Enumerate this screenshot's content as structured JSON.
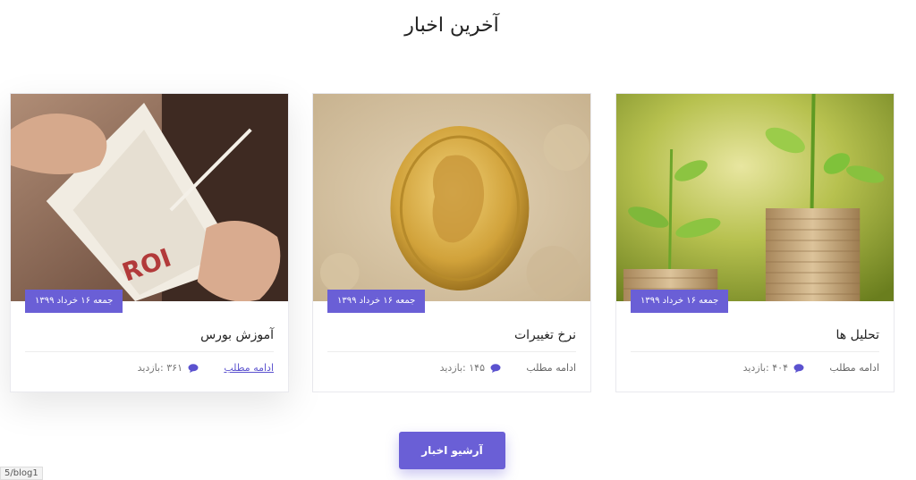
{
  "section": {
    "title": "آخرین اخبار"
  },
  "cards": [
    {
      "date": "جمعه ۱۶ خرداد ۱۳۹۹",
      "title": "تحلیل ها",
      "read_more": "ادامه مطلب",
      "views": "۴۰۴ :بازدید",
      "image": "plants-on-coins"
    },
    {
      "date": "جمعه ۱۶ خرداد ۱۳۹۹",
      "title": "نرخ تغییرات",
      "read_more": "ادامه مطلب",
      "views": "۱۴۵ :بازدید",
      "image": "gold-coin"
    },
    {
      "date": "جمعه ۱۶ خرداد ۱۳۹۹",
      "title": "آموزش بورس",
      "read_more": "ادامه مطلب",
      "views": "۳۶۱ :بازدید",
      "image": "writing-in-book"
    }
  ],
  "archive_button": {
    "label": "آرشیو اخبار"
  },
  "url_hint": "5/blog1",
  "colors": {
    "accent": "#6a5fd6"
  }
}
